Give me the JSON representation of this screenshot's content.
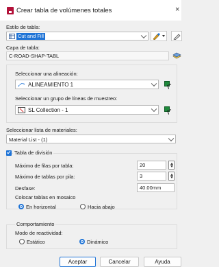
{
  "window": {
    "title": "Crear tabla de volúmenes totales",
    "close_glyph": "×"
  },
  "table_style": {
    "label": "Estilo de tabla:",
    "value": "Cut and Fill"
  },
  "table_layer": {
    "label": "Capa de tabla:",
    "value": "C-ROAD-SHAP-TABL"
  },
  "alignment": {
    "label": "Seleccionar una alineación:",
    "value": "ALINEAMIENTO 1"
  },
  "sample_lines": {
    "label": "Seleccionar un grupo de líneas de muestreo:",
    "value": "SL Collection - 1"
  },
  "materials": {
    "label": "Seleccionar lista de materiales:",
    "value": "Material List - (1)"
  },
  "split_table": {
    "label": "Tabla de división",
    "checked": true,
    "max_rows": {
      "label": "Máximo de filas por tabla:",
      "value": "20"
    },
    "max_tables": {
      "label": "Máximo de tablas por pila:",
      "value": "3"
    },
    "offset": {
      "label": "Desfase:",
      "value": "40.00mm"
    },
    "tile_label": "Colocar tablas en mosaico",
    "horizontal": "En horizontal",
    "down": "Hacia abajo"
  },
  "behavior": {
    "label": "Comportamiento",
    "mode_label": "Modo de reactividad:",
    "static": "Estático",
    "dynamic": "Dinámico"
  },
  "buttons": {
    "accept": "Aceptar",
    "cancel": "Cancelar",
    "help": "Ayuda"
  },
  "colors": {
    "accent": "#1e73d6",
    "app_icon": "#b3123a",
    "pick_green": "#1f8a3c"
  }
}
